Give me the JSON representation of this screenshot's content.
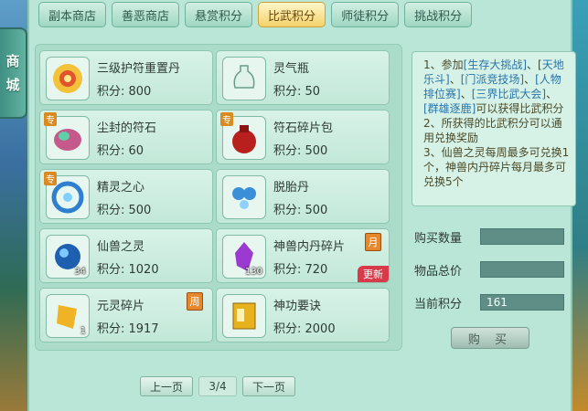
{
  "sidebar": {
    "tab_label_1": "商",
    "tab_label_2": "城"
  },
  "tabs": [
    {
      "label": "副本商店"
    },
    {
      "label": "善恶商店"
    },
    {
      "label": "悬赏积分"
    },
    {
      "label": "比武积分",
      "active": true
    },
    {
      "label": "师徒积分"
    },
    {
      "label": "挑战积分"
    }
  ],
  "items": [
    {
      "name": "三级护符重置丹",
      "score": "积分: 800",
      "icon": "golden-flower-icon"
    },
    {
      "name": "灵气瓶",
      "score": "积分: 50",
      "icon": "jade-vase-icon"
    },
    {
      "name": "尘封的符石",
      "score": "积分: 60",
      "icon": "rune-stone-icon",
      "badge": "专"
    },
    {
      "name": "符石碎片包",
      "score": "积分: 500",
      "icon": "red-pouch-icon",
      "badge": "专"
    },
    {
      "name": "精灵之心",
      "score": "积分: 500",
      "icon": "spirit-heart-icon",
      "badge": "专"
    },
    {
      "name": "脱胎丹",
      "score": "积分: 500",
      "icon": "blue-pill-icon"
    },
    {
      "name": "仙兽之灵",
      "score": "积分: 1020",
      "icon": "blue-orb-icon",
      "count": "34"
    },
    {
      "name": "神兽内丹碎片",
      "score": "积分: 720",
      "icon": "purple-crystal-icon",
      "count": "130",
      "tag": "月",
      "new_tag": "更新"
    },
    {
      "name": "元灵碎片",
      "score": "积分: 1917",
      "icon": "gold-shard-icon",
      "count": "1",
      "tag": "周"
    },
    {
      "name": "神功要诀",
      "score": "积分: 2000",
      "icon": "golden-book-icon"
    }
  ],
  "info": {
    "line1a": "1、参加",
    "link1": "[生存大挑战]",
    "sep1": "、[",
    "link2": "天地乐斗]",
    "sep2": "、",
    "link3": "[门派竞技场]",
    "sep3": "、",
    "link4": "[人物排位赛]",
    "sep4": "、",
    "link5": "[三界比武大会]",
    "sep5": "、",
    "link6": "[群雄逐鹿]",
    "line1b": "可以获得比武积分",
    "line2": "2、所获得的比武积分可以通用兑换奖励",
    "line3": "3、仙兽之灵每周最多可兑换1个，神兽内丹碎片每月最多可兑换5个"
  },
  "fields": {
    "qty_label": "购买数量",
    "qty_value": "",
    "total_label": "物品总价",
    "total_value": "",
    "points_label": "当前积分",
    "points_value": "161"
  },
  "buy_label": "购 买",
  "pager": {
    "prev": "上一页",
    "page": "3/4",
    "next": "下一页"
  }
}
